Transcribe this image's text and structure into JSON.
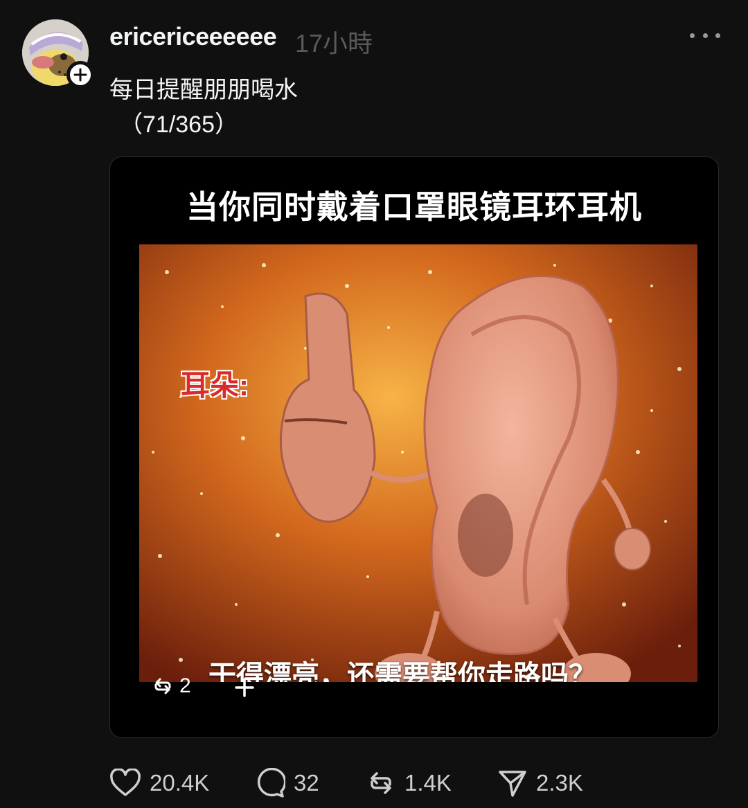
{
  "post": {
    "username": "ericericeeeeee",
    "timestamp": "17小時",
    "caption_line1": "每日提醒朋朋喝水",
    "caption_line2": "（71/365）"
  },
  "media": {
    "title": "当你同时戴着口罩眼镜耳环耳机",
    "label": "耳朵:",
    "subtitle": "干得漂亮，还需要帮你走路吗？",
    "repost_count": "2"
  },
  "actions": {
    "likes": "20.4K",
    "comments": "32",
    "reposts": "1.4K",
    "shares": "2.3K"
  },
  "icons": {
    "more": "more-horizontal-icon",
    "like": "heart-icon",
    "comment": "comment-bubble-icon",
    "repost": "repost-icon",
    "share": "send-icon",
    "follow": "plus-icon"
  },
  "colors": {
    "background": "#101010",
    "text": "#f3f5f7",
    "muted": "#5a5a5a",
    "meme_label": "#d92b2b"
  }
}
